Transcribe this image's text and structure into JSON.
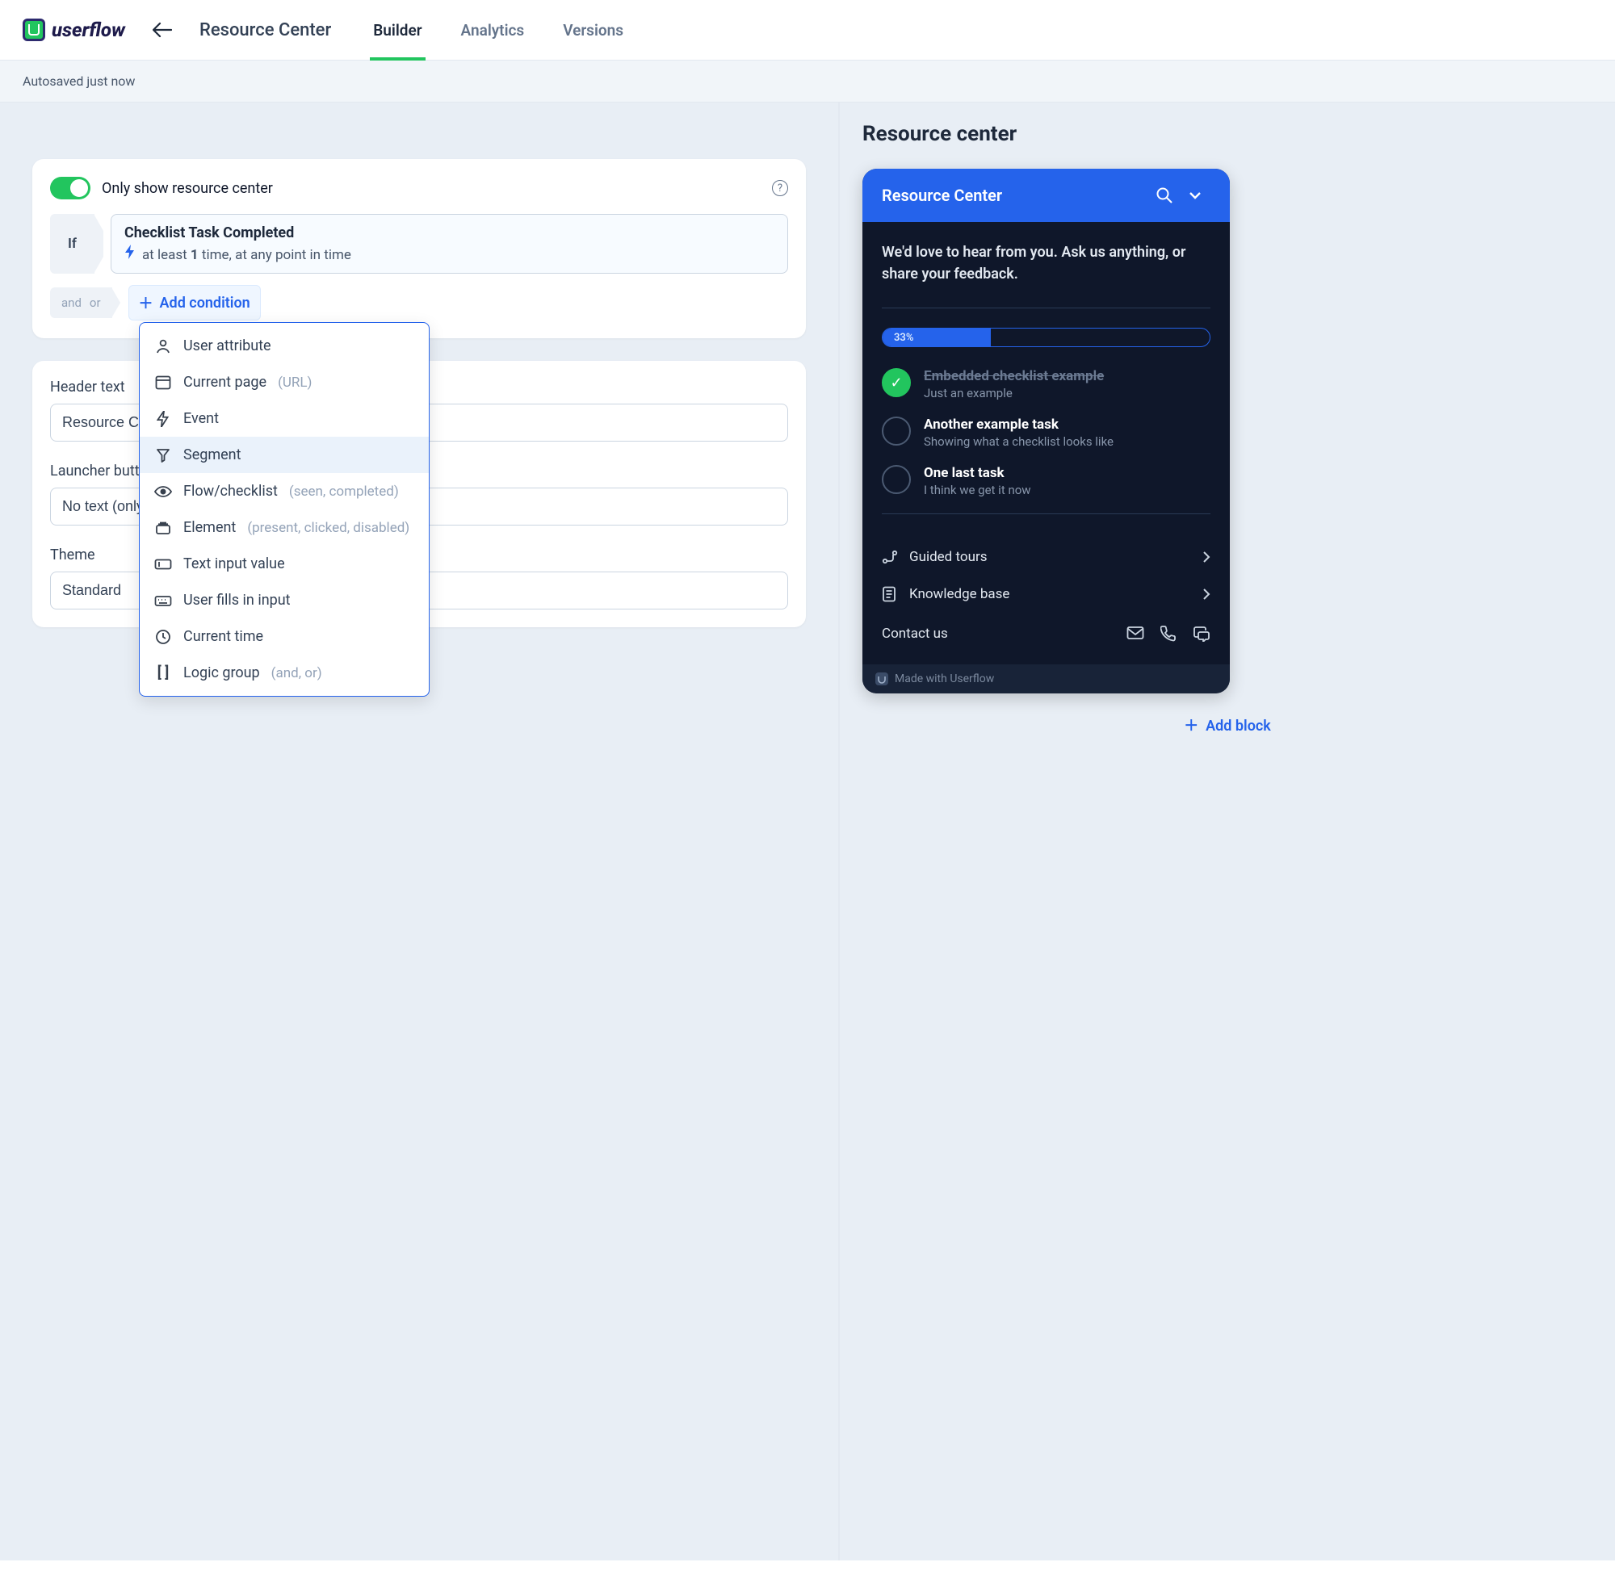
{
  "brand": "userflow",
  "header": {
    "page_title": "Resource Center",
    "tabs": [
      "Builder",
      "Analytics",
      "Versions"
    ],
    "active_tab": 0
  },
  "subheader": "Autosaved just now",
  "left": {
    "toggle_label": "Only show resource center",
    "if_label": "If",
    "condition": {
      "title": "Checklist Task Completed",
      "detail_prefix": "at least ",
      "detail_bold": "1",
      "detail_suffix": " time, at any point in time"
    },
    "andor": {
      "and": "and",
      "or": "or"
    },
    "add_condition": "Add condition",
    "dropdown": [
      {
        "label": "User attribute",
        "hint": ""
      },
      {
        "label": "Current page",
        "hint": "(URL)"
      },
      {
        "label": "Event",
        "hint": ""
      },
      {
        "label": "Segment",
        "hint": ""
      },
      {
        "label": "Flow/checklist",
        "hint": "(seen, completed)"
      },
      {
        "label": "Element",
        "hint": "(present, clicked, disabled)"
      },
      {
        "label": "Text input value",
        "hint": ""
      },
      {
        "label": "User fills in input",
        "hint": ""
      },
      {
        "label": "Current time",
        "hint": ""
      },
      {
        "label": "Logic group",
        "hint": "(and, or)"
      }
    ],
    "header_text_label": "Header text",
    "header_text_value": "Resource Center",
    "launcher_label": "Launcher button",
    "launcher_value": "No text (only icon)",
    "theme_label": "Theme",
    "theme_value": "Standard"
  },
  "right": {
    "title": "Resource center",
    "rc_title": "Resource Center",
    "headline": "We'd love to hear from you. Ask us anything, or share your feedback.",
    "progress_pct": 33,
    "progress_label": "33%",
    "tasks": [
      {
        "title": "Embedded checklist example",
        "sub": "Just an example",
        "done": true
      },
      {
        "title": "Another example task",
        "sub": "Showing what a checklist looks like",
        "done": false
      },
      {
        "title": "One last task",
        "sub": "I think we get it now",
        "done": false
      }
    ],
    "rows": [
      {
        "label": "Guided tours"
      },
      {
        "label": "Knowledge base"
      }
    ],
    "contact_label": "Contact us",
    "footer": "Made with Userflow",
    "add_block": "Add block"
  }
}
